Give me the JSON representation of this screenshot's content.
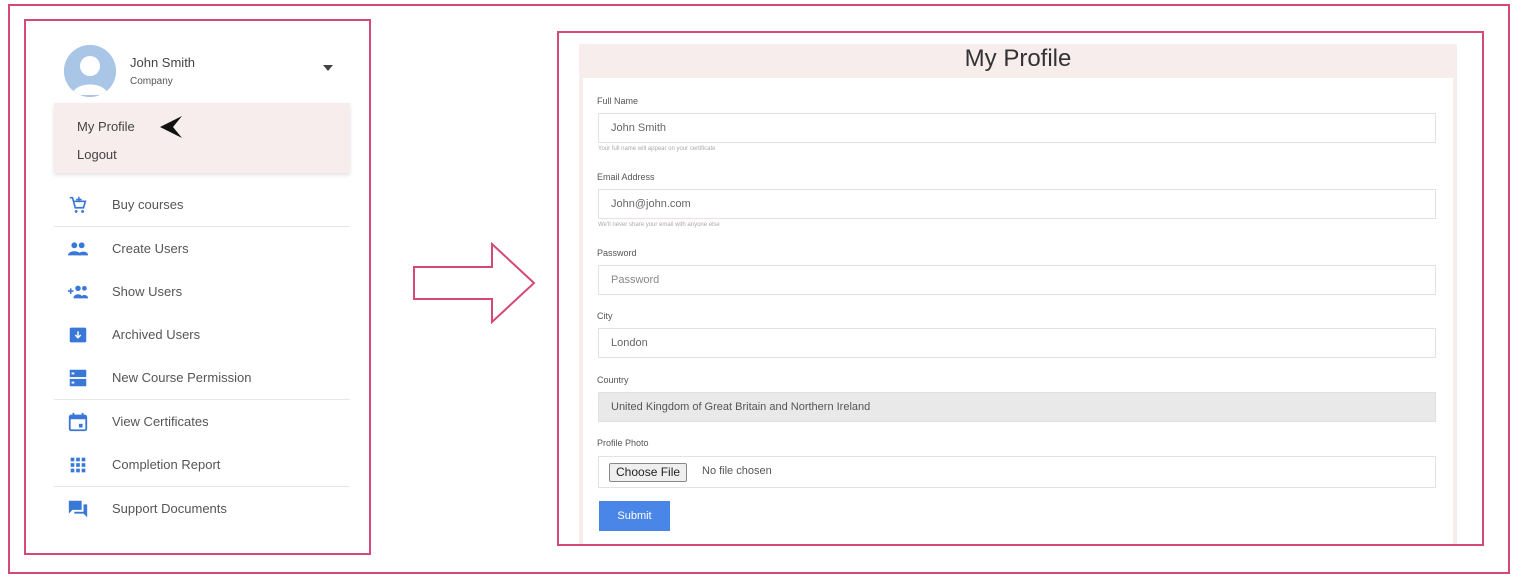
{
  "user": {
    "name": "John Smith",
    "company": "Company"
  },
  "dropdown": {
    "profile_label": "My Profile",
    "logout_label": "Logout"
  },
  "menu": {
    "items": [
      {
        "label": "Buy courses",
        "icon": "cart-icon"
      },
      {
        "label": "Create Users",
        "icon": "users-group-icon"
      },
      {
        "label": "Show Users",
        "icon": "add-users-icon"
      },
      {
        "label": "Archived Users",
        "icon": "archive-box-icon"
      },
      {
        "label": "New Course Permission",
        "icon": "storage-icon"
      },
      {
        "label": "View Certificates",
        "icon": "calendar-icon"
      },
      {
        "label": "Completion Report",
        "icon": "grid-dots-icon"
      },
      {
        "label": "Support Documents",
        "icon": "chat-bubbles-icon"
      }
    ]
  },
  "profile_form": {
    "title": "My Profile",
    "full_name": {
      "label": "Full Name",
      "value": "John Smith",
      "help": "Your full name will appear on your certificate"
    },
    "email": {
      "label": "Email Address",
      "value": "John@john.com",
      "help": "We'll never share your email with anyone else"
    },
    "password": {
      "label": "Password",
      "placeholder": "Password"
    },
    "city": {
      "label": "City",
      "value": "London"
    },
    "country": {
      "label": "Country",
      "value": "United Kingdom of Great Britain and Northern Ireland"
    },
    "photo": {
      "label": "Profile Photo",
      "button_label": "Choose File",
      "status": "No file chosen"
    },
    "submit_label": "Submit"
  },
  "colors": {
    "frame": "#d6477a",
    "accent": "#4a86e8",
    "icon": "#3a78d8",
    "panel_bg": "#f7eded"
  }
}
